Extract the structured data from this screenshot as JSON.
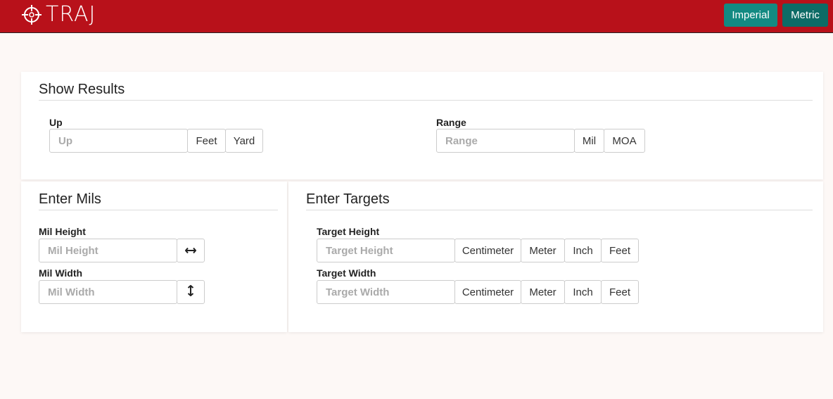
{
  "header": {
    "brand": "TRAJ",
    "logo_icon": "crosshair-icon",
    "imperial_label": "Imperial",
    "metric_label": "Metric",
    "colors": {
      "navbar": "#b8111a",
      "imperial": "#138a82",
      "metric": "#0d6b66"
    }
  },
  "show_results": {
    "title": "Show Results",
    "up": {
      "label": "Up",
      "placeholder": "Up",
      "units": [
        "Feet",
        "Yard"
      ]
    },
    "range": {
      "label": "Range",
      "placeholder": "Range",
      "units": [
        "Mil",
        "MOA"
      ]
    }
  },
  "enter_mils": {
    "title": "Enter Mils",
    "mil_height": {
      "label": "Mil Height",
      "placeholder": "Mil Height",
      "icon": "horizontal-arrows-icon"
    },
    "mil_width": {
      "label": "Mil Width",
      "placeholder": "Mil Width",
      "icon": "vertical-arrows-icon"
    }
  },
  "enter_targets": {
    "title": "Enter Targets",
    "target_height": {
      "label": "Target Height",
      "placeholder": "Target Height",
      "units": [
        "Centimeter",
        "Meter",
        "Inch",
        "Feet"
      ]
    },
    "target_width": {
      "label": "Target Width",
      "placeholder": "Target Width",
      "units": [
        "Centimeter",
        "Meter",
        "Inch",
        "Feet"
      ]
    }
  }
}
